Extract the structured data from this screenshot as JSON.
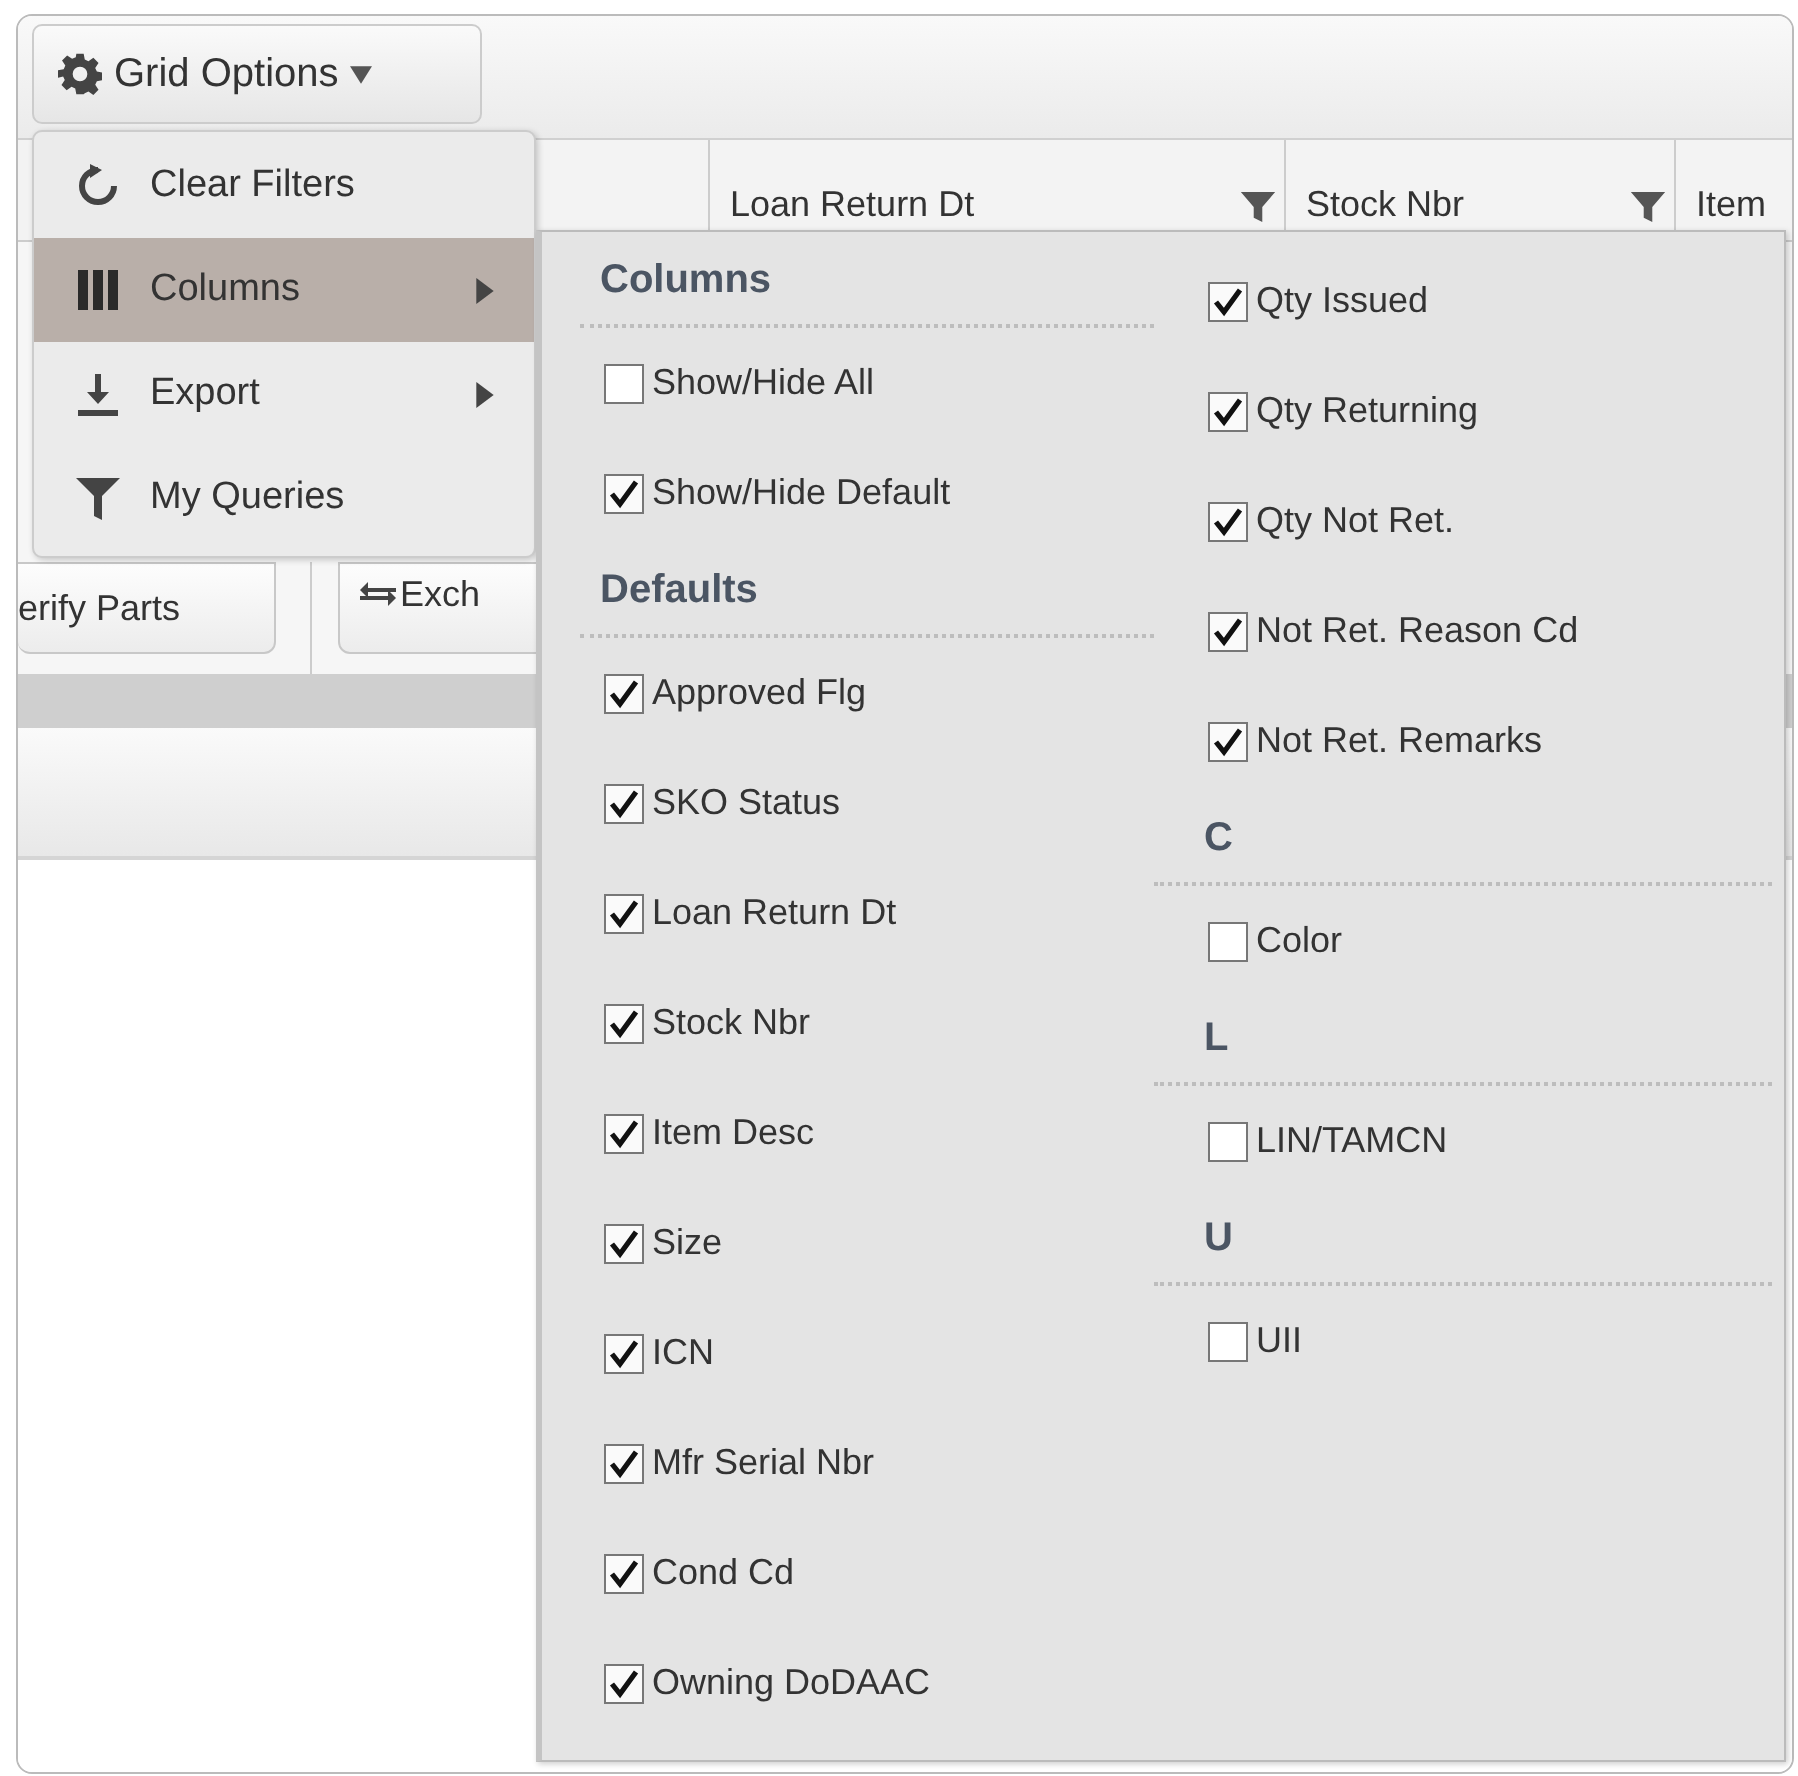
{
  "toolbar": {
    "grid_options_label": "Grid Options"
  },
  "grid_headers": [
    {
      "filter": false
    },
    {
      "label": "Loan Return Dt",
      "filter": true
    },
    {
      "label": "Stock Nbr",
      "filter": true
    },
    {
      "label": "Item",
      "filter": false
    }
  ],
  "action_buttons": [
    {
      "label": "erify Parts",
      "kind": "text"
    },
    {
      "label": "Exch",
      "kind": "exchange"
    }
  ],
  "menu": [
    {
      "label": "Clear Filters",
      "kind": "refresh",
      "submenu": false,
      "selected": false
    },
    {
      "label": "Columns",
      "kind": "columns",
      "submenu": true,
      "selected": true
    },
    {
      "label": "Export",
      "kind": "download",
      "submenu": true,
      "selected": false
    },
    {
      "label": "My Queries",
      "kind": "filter",
      "submenu": false,
      "selected": false
    }
  ],
  "columns_panel": {
    "columns": [
      [
        {
          "kind": "heading",
          "label": "Columns"
        },
        {
          "kind": "checkbox",
          "label": "Show/Hide All",
          "checked": false
        },
        {
          "kind": "checkbox",
          "label": "Show/Hide Default",
          "checked": true
        },
        {
          "kind": "heading",
          "label": "Defaults"
        },
        {
          "kind": "checkbox",
          "label": "Approved Flg",
          "checked": true
        },
        {
          "kind": "checkbox",
          "label": "SKO Status",
          "checked": true
        },
        {
          "kind": "checkbox",
          "label": "Loan Return Dt",
          "checked": true
        },
        {
          "kind": "checkbox",
          "label": "Stock Nbr",
          "checked": true
        },
        {
          "kind": "checkbox",
          "label": "Item Desc",
          "checked": true
        },
        {
          "kind": "checkbox",
          "label": "Size",
          "checked": true
        },
        {
          "kind": "checkbox",
          "label": "ICN",
          "checked": true
        },
        {
          "kind": "checkbox",
          "label": "Mfr Serial Nbr",
          "checked": true
        },
        {
          "kind": "checkbox",
          "label": "Cond Cd",
          "checked": true
        },
        {
          "kind": "checkbox",
          "label": "Owning DoDAAC",
          "checked": true
        }
      ],
      [
        {
          "kind": "checkbox",
          "label": "Qty Issued",
          "checked": true
        },
        {
          "kind": "checkbox",
          "label": "Qty Returning",
          "checked": true
        },
        {
          "kind": "checkbox",
          "label": "Qty Not Ret.",
          "checked": true
        },
        {
          "kind": "checkbox",
          "label": "Not Ret. Reason Cd",
          "checked": true
        },
        {
          "kind": "checkbox",
          "label": "Not Ret. Remarks",
          "checked": true
        },
        {
          "kind": "heading",
          "label": "C"
        },
        {
          "kind": "checkbox",
          "label": "Color",
          "checked": false
        },
        {
          "kind": "heading",
          "label": "L"
        },
        {
          "kind": "checkbox",
          "label": "LIN/TAMCN",
          "checked": false
        },
        {
          "kind": "heading",
          "label": "U"
        },
        {
          "kind": "checkbox",
          "label": "UII",
          "checked": false
        }
      ]
    ]
  }
}
